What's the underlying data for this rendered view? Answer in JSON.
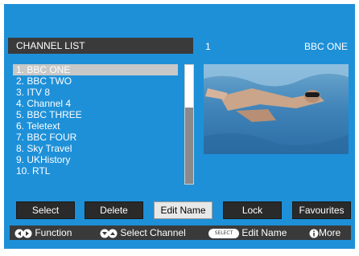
{
  "header": {
    "title": "CHANNEL LIST",
    "current_number": "1",
    "current_channel": "BBC ONE"
  },
  "channels": [
    {
      "label": "1. BBC ONE",
      "selected": true
    },
    {
      "label": "2. BBC TWO",
      "selected": false
    },
    {
      "label": "3. ITV 8",
      "selected": false
    },
    {
      "label": "4. Channel 4",
      "selected": false
    },
    {
      "label": "5. BBC THREE",
      "selected": false
    },
    {
      "label": "6. Teletext",
      "selected": false
    },
    {
      "label": "7. BBC FOUR",
      "selected": false
    },
    {
      "label": "8. Sky Travel",
      "selected": false
    },
    {
      "label": "9. UKHistory",
      "selected": false
    },
    {
      "label": "10. RTL",
      "selected": false
    }
  ],
  "buttons": {
    "select": "Select",
    "delete": "Delete",
    "edit_name": "Edit Name",
    "lock": "Lock",
    "favourites": "Favourites"
  },
  "footer": {
    "function": "Function",
    "select_channel": "Select Channel",
    "select_key": "SELECT",
    "edit_name": "Edit Name",
    "more": "More"
  },
  "colors": {
    "panel": "#1e90d8",
    "bar": "#3a3a3a",
    "highlight": "#c8c8c8"
  }
}
